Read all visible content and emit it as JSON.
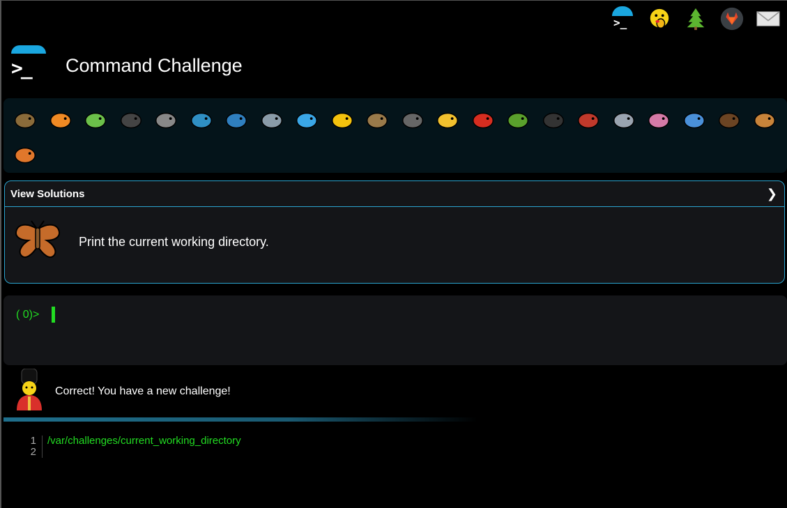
{
  "header": {
    "title": "Command Challenge",
    "logo_text": ">_"
  },
  "top_icons": [
    {
      "name": "terminal-logo-icon"
    },
    {
      "name": "hand-over-mouth-emoji-icon"
    },
    {
      "name": "evergreen-tree-icon"
    },
    {
      "name": "gitlab-icon"
    },
    {
      "name": "envelope-icon"
    }
  ],
  "challenges": [
    {
      "name": "snail",
      "color": "#8a6b3a"
    },
    {
      "name": "butterfly",
      "color": "#f08a24"
    },
    {
      "name": "caterpillar",
      "color": "#6cc04a"
    },
    {
      "name": "ant",
      "color": "#444444"
    },
    {
      "name": "spider-web",
      "color": "#888888"
    },
    {
      "name": "whale",
      "color": "#2f8fc4"
    },
    {
      "name": "dolphin",
      "color": "#2f7fbf"
    },
    {
      "name": "dolphin-gray",
      "color": "#8a9ba8"
    },
    {
      "name": "fish",
      "color": "#3aa6e6"
    },
    {
      "name": "tropical-fish",
      "color": "#f4c20d"
    },
    {
      "name": "blowfish",
      "color": "#9a7a4a"
    },
    {
      "name": "wolf",
      "color": "#666666"
    },
    {
      "name": "bee",
      "color": "#f2c12e"
    },
    {
      "name": "ladybug",
      "color": "#d62d20"
    },
    {
      "name": "cricket",
      "color": "#5aa02c"
    },
    {
      "name": "spider",
      "color": "#333333"
    },
    {
      "name": "scorpion",
      "color": "#c0392b"
    },
    {
      "name": "fly",
      "color": "#9aa4b0"
    },
    {
      "name": "worm",
      "color": "#d57aa7"
    },
    {
      "name": "microbe",
      "color": "#4a90d9"
    },
    {
      "name": "monkey",
      "color": "#6b4423"
    },
    {
      "name": "dog",
      "color": "#c8843a"
    },
    {
      "name": "fox",
      "color": "#e0772b"
    }
  ],
  "solutions": {
    "label": "View Solutions",
    "chevron": "❯",
    "description": "Print the current working directory."
  },
  "terminal": {
    "prompt": "( 0)>"
  },
  "feedback": {
    "message": "Correct! You have a new challenge!"
  },
  "code": {
    "lines": [
      {
        "num": "1",
        "text": "/var/challenges/current_working_directory"
      },
      {
        "num": "2",
        "text": ""
      }
    ]
  },
  "colors": {
    "accent": "#2ba4cf",
    "terminal_green": "#22dd22"
  }
}
